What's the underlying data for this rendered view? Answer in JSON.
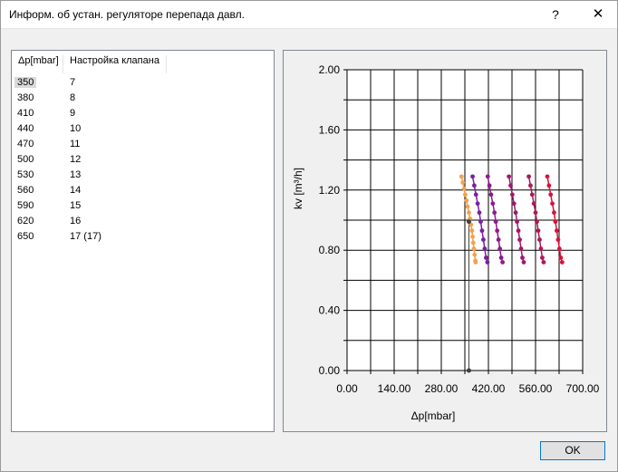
{
  "window": {
    "title": "Информ. об устан. регуляторе перепада давл.",
    "help_label": "?",
    "close_label": "✕"
  },
  "table": {
    "columns": [
      "Δp[mbar]",
      "Настройка клапана"
    ],
    "rows": [
      [
        "350",
        "7"
      ],
      [
        "380",
        "8"
      ],
      [
        "410",
        "9"
      ],
      [
        "440",
        "10"
      ],
      [
        "470",
        "11"
      ],
      [
        "500",
        "12"
      ],
      [
        "530",
        "13"
      ],
      [
        "560",
        "14"
      ],
      [
        "590",
        "15"
      ],
      [
        "620",
        "16"
      ],
      [
        "650",
        "17 (17)"
      ]
    ]
  },
  "chart_data": {
    "type": "scatter",
    "xlabel": "Δp[mbar]",
    "ylabel": "kv  [m³/h]",
    "xlim": [
      0,
      700
    ],
    "ylim": [
      0,
      2.0
    ],
    "xticks": [
      "0.00",
      "140.00",
      "280.00",
      "420.00",
      "560.00",
      "700.00"
    ],
    "yticks": [
      "0.00",
      "0.40",
      "0.80",
      "1.20",
      "1.60",
      "2.00"
    ],
    "grid": true,
    "series": [
      {
        "color": "#f5a04a",
        "points": [
          [
            340,
            1.29
          ],
          [
            344,
            1.25
          ],
          [
            348,
            1.21
          ],
          [
            351,
            1.17
          ],
          [
            355,
            1.13
          ],
          [
            358,
            1.09
          ],
          [
            362,
            1.05
          ],
          [
            365,
            1.01
          ],
          [
            368,
            0.97
          ],
          [
            371,
            0.93
          ],
          [
            373,
            0.89
          ],
          [
            375,
            0.85
          ],
          [
            377,
            0.81
          ],
          [
            379,
            0.77
          ],
          [
            381,
            0.73
          ],
          [
            382,
            0.72
          ]
        ]
      },
      {
        "color": "#7a1fa2",
        "points": [
          [
            373,
            1.29
          ],
          [
            378,
            1.23
          ],
          [
            383,
            1.17
          ],
          [
            388,
            1.11
          ],
          [
            393,
            1.05
          ],
          [
            397,
            0.99
          ],
          [
            401,
            0.93
          ],
          [
            405,
            0.87
          ],
          [
            409,
            0.81
          ],
          [
            413,
            0.75
          ],
          [
            417,
            0.72
          ]
        ]
      },
      {
        "color": "#8e1a8e",
        "points": [
          [
            418,
            1.29
          ],
          [
            423,
            1.23
          ],
          [
            428,
            1.17
          ],
          [
            433,
            1.11
          ],
          [
            438,
            1.05
          ],
          [
            442,
            0.99
          ],
          [
            446,
            0.93
          ],
          [
            450,
            0.87
          ],
          [
            454,
            0.81
          ],
          [
            458,
            0.75
          ],
          [
            462,
            0.72
          ]
        ]
      },
      {
        "color": "#a0186e",
        "points": [
          [
            481,
            1.29
          ],
          [
            486,
            1.23
          ],
          [
            491,
            1.17
          ],
          [
            496,
            1.11
          ],
          [
            501,
            1.05
          ],
          [
            505,
            0.99
          ],
          [
            509,
            0.93
          ],
          [
            513,
            0.87
          ],
          [
            517,
            0.81
          ],
          [
            521,
            0.75
          ],
          [
            525,
            0.72
          ]
        ]
      },
      {
        "color": "#b01658",
        "points": [
          [
            540,
            1.29
          ],
          [
            545,
            1.23
          ],
          [
            550,
            1.17
          ],
          [
            555,
            1.11
          ],
          [
            560,
            1.05
          ],
          [
            564,
            0.99
          ],
          [
            568,
            0.93
          ],
          [
            572,
            0.87
          ],
          [
            576,
            0.81
          ],
          [
            580,
            0.75
          ],
          [
            584,
            0.72
          ]
        ]
      },
      {
        "color": "#d8123a",
        "points": [
          [
            595,
            1.29
          ],
          [
            600,
            1.23
          ],
          [
            605,
            1.17
          ],
          [
            610,
            1.11
          ],
          [
            615,
            1.05
          ],
          [
            619,
            0.99
          ],
          [
            623,
            0.93
          ],
          [
            627,
            0.87
          ],
          [
            631,
            0.81
          ],
          [
            635,
            0.75
          ],
          [
            639,
            0.72
          ]
        ]
      }
    ],
    "marker_line": {
      "x": 362,
      "y_top": 0.99,
      "color": "#404040"
    }
  },
  "buttons": {
    "ok_label": "OK"
  }
}
